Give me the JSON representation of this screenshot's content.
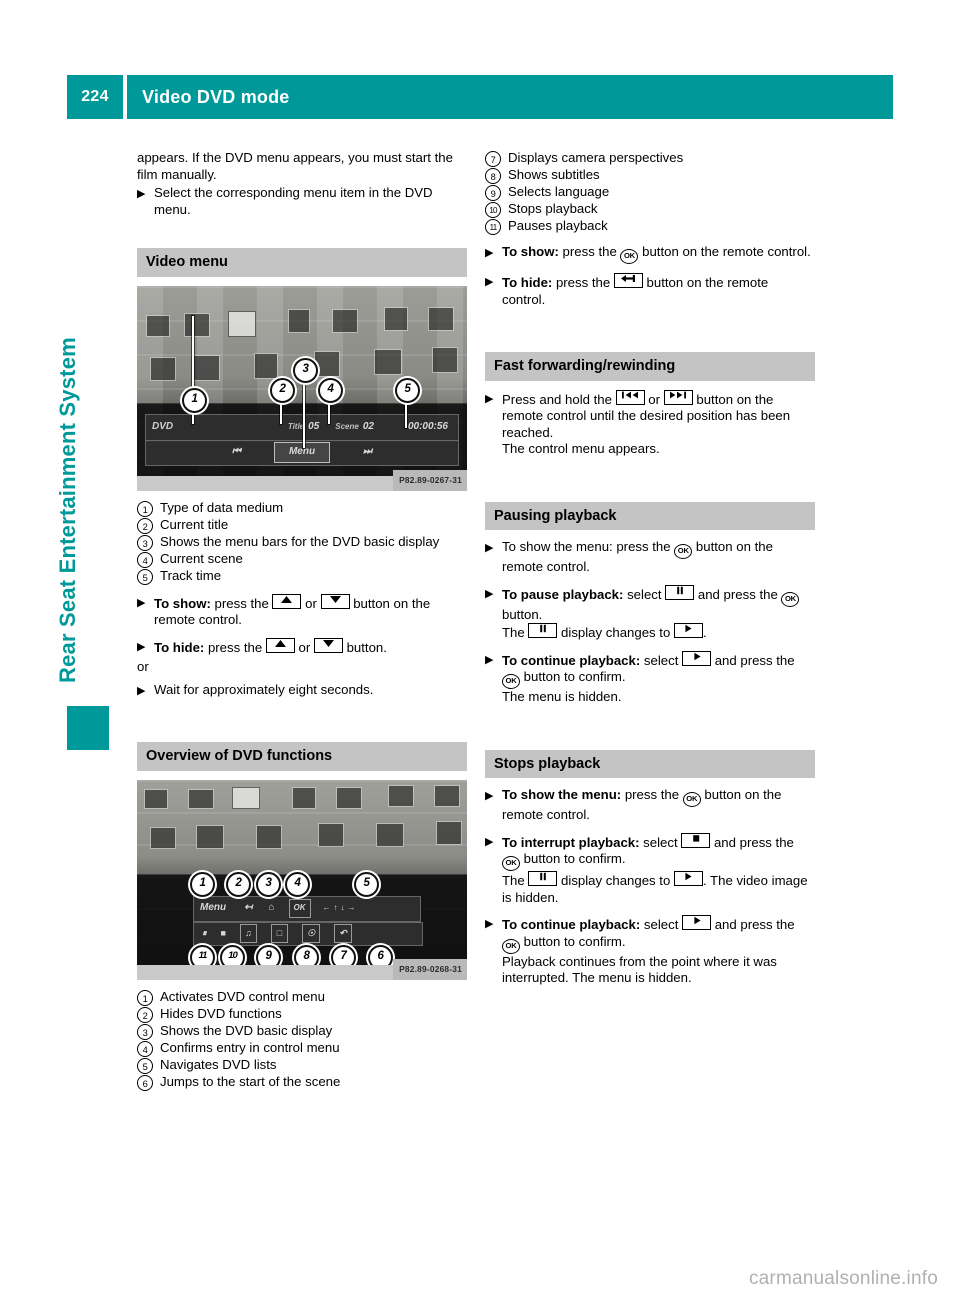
{
  "header": {
    "page_number": "224",
    "title": "Video DVD mode"
  },
  "side_tab": {
    "label": "Rear Seat Entertainment System"
  },
  "watermark": "carmanualsonline.info",
  "colors": {
    "accent_teal": "#00999a",
    "section_header_gray": "#c4c4c4",
    "caption_gray": "#b9b9b9"
  },
  "left_column": {
    "intro_paragraph": "appears. If the DVD menu appears, you must start the film manually.",
    "intro_step": "Select the corresponding menu item in the DVD menu.",
    "video_menu": {
      "heading": "Video menu",
      "figure": {
        "caption_code": "P82.89-0267-31",
        "osd_labels": {
          "title_label": "Title",
          "title_value": "05",
          "scene_label": "Scene",
          "scene_value": "02",
          "time_value": "00:00:56",
          "menu_button": "Menu"
        },
        "markers": [
          "1",
          "2",
          "3",
          "4",
          "5"
        ]
      },
      "legend": [
        {
          "num": "1",
          "text": "Type of data medium"
        },
        {
          "num": "2",
          "text": "Current title"
        },
        {
          "num": "3",
          "text": "Shows the menu bars for the DVD basic display"
        },
        {
          "num": "4",
          "text": "Current scene"
        },
        {
          "num": "5",
          "text": "Track time"
        }
      ],
      "steps": [
        {
          "lead": "To show:",
          "parts": [
            "press the ",
            "KEY_UP",
            " or ",
            "KEY_DOWN",
            " button on the remote control."
          ]
        },
        {
          "lead": "To hide:",
          "parts": [
            "press the ",
            "KEY_UP",
            " or ",
            "KEY_DOWN",
            " button."
          ]
        }
      ],
      "or_text": "or",
      "wait_step": "Wait for approximately eight seconds."
    },
    "overview": {
      "heading": "Overview of DVD functions",
      "figure": {
        "caption_code": "P82.89-0268-31",
        "osd_labels": {
          "menu_button": "Menu",
          "ok_button": "OK"
        },
        "markers_top": [
          "1",
          "2",
          "3",
          "4",
          "5"
        ],
        "markers_bottom": [
          "11",
          "10",
          "9",
          "8",
          "7",
          "6"
        ]
      },
      "legend": [
        {
          "num": "1",
          "text": "Activates DVD control menu"
        },
        {
          "num": "2",
          "text": "Hides DVD functions"
        },
        {
          "num": "3",
          "text": "Shows the DVD basic display"
        },
        {
          "num": "4",
          "text": "Confirms entry in control menu"
        },
        {
          "num": "5",
          "text": "Navigates DVD lists"
        },
        {
          "num": "6",
          "text": "Jumps to the start of the scene"
        }
      ]
    }
  },
  "right_column": {
    "legend_continued": [
      {
        "num": "7",
        "text": "Displays camera perspectives"
      },
      {
        "num": "8",
        "text": "Shows subtitles"
      },
      {
        "num": "9",
        "text": "Selects language"
      },
      {
        "num": "10",
        "text": "Stops playback"
      },
      {
        "num": "11",
        "text": "Pauses playback"
      }
    ],
    "show_hide_steps": [
      {
        "lead": "To show:",
        "parts": [
          "press the ",
          "KEY_OK",
          " button on the remote control."
        ]
      },
      {
        "lead": "To hide:",
        "parts": [
          "press the ",
          "KEY_BACK",
          " button on the remote control."
        ]
      }
    ],
    "fast_forward": {
      "heading": "Fast forwarding/rewinding",
      "step": {
        "parts": [
          "Press and hold the ",
          "KEY_PREV",
          " or ",
          "KEY_NEXT",
          " button on the remote control until the desired position has been reached."
        ],
        "result": "The control menu appears."
      }
    },
    "pausing": {
      "heading": "Pausing playback",
      "steps": [
        {
          "lead": "",
          "parts": [
            "To show the menu: press the ",
            "KEY_OK",
            " button on the remote control."
          ]
        },
        {
          "lead": "To pause playback:",
          "parts": [
            " select ",
            "KEY_PAUSE",
            " and press the ",
            "KEY_OK",
            " button."
          ],
          "extra_parts": [
            "The ",
            "KEY_PAUSE",
            " display changes to ",
            "KEY_PLAY",
            "."
          ]
        },
        {
          "lead": "To continue playback:",
          "parts": [
            " select ",
            "KEY_PLAY",
            " and press the ",
            "KEY_OK",
            " button to confirm."
          ],
          "extra": "The menu is hidden."
        }
      ]
    },
    "stopping": {
      "heading": "Stops playback",
      "steps": [
        {
          "lead": "To show the menu:",
          "parts": [
            " press the ",
            "KEY_OK",
            " button on the remote control."
          ]
        },
        {
          "lead": "To interrupt playback:",
          "parts": [
            " select ",
            "KEY_STOP",
            " and press the ",
            "KEY_OK",
            " button to confirm."
          ],
          "extra_parts": [
            "The ",
            "KEY_PAUSE",
            " display changes to ",
            "KEY_PLAY",
            ". The video image is hidden."
          ]
        },
        {
          "lead": "To continue playback:",
          "parts": [
            " select ",
            "KEY_PLAY",
            " and press the ",
            "KEY_OK",
            " button to confirm."
          ],
          "extra": "Playback continues from the point where it was interrupted. The menu is hidden."
        }
      ]
    }
  },
  "icon_names": {
    "KEY_UP": "arrow-up-key-icon",
    "KEY_DOWN": "arrow-down-key-icon",
    "KEY_OK": "ok-key-icon",
    "KEY_BACK": "back-key-icon",
    "KEY_PREV": "rewind-key-icon",
    "KEY_NEXT": "fast-forward-key-icon",
    "KEY_PAUSE": "pause-key-icon",
    "KEY_PLAY": "play-key-icon",
    "KEY_STOP": "stop-key-icon"
  },
  "ok_key_text": "OK",
  "step_arrow_glyph": "▶"
}
